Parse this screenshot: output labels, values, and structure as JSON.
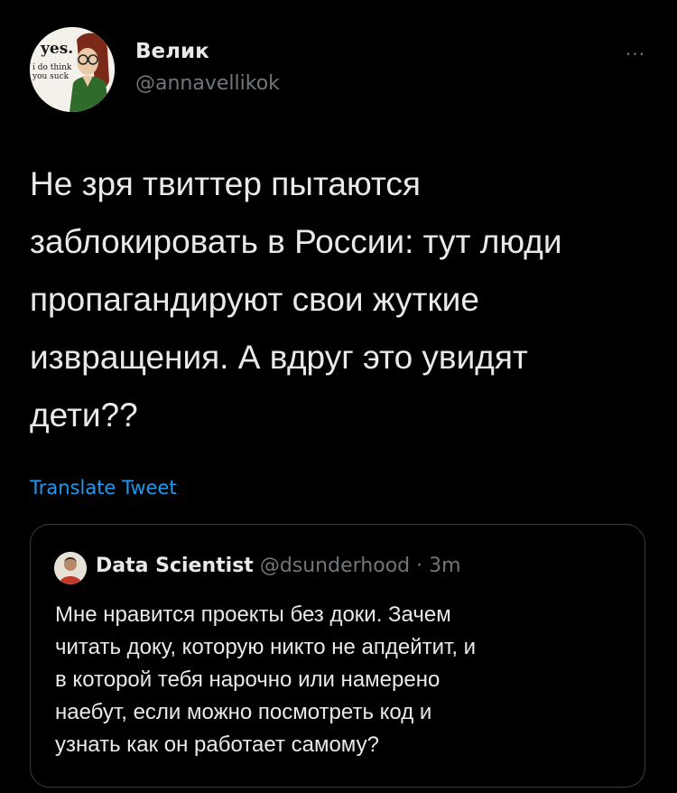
{
  "author": {
    "name": "Велик",
    "handle": "@annavellikok",
    "avatar_text_top": "yes.",
    "avatar_text_bottom": "i do think you suck"
  },
  "more_label": "···",
  "tweet": {
    "lines": [
      "Не зря твиттер пытаются",
      "заблокировать в России: тут люди",
      "пропагандируют свои жуткие",
      "извращения. А вдруг это увидят",
      "дети??"
    ]
  },
  "translate_label": "Translate Tweet",
  "quoted": {
    "name": "Data Scientist",
    "handle": "@dsunderhood",
    "separator": " · ",
    "time": "3m",
    "lines": [
      "Мне нравится проекты без доки. Зачем",
      "читать доку, которую никто не апдейтит, и",
      "в которой тебя нарочно или намерено",
      "наебут, если можно посмотреть код и",
      "узнать как он работает самому?"
    ]
  },
  "colors": {
    "background": "#000000",
    "text": "#e7e9ea",
    "secondary": "#71767b",
    "link": "#1d9bf0",
    "border": "#3a3d41"
  }
}
